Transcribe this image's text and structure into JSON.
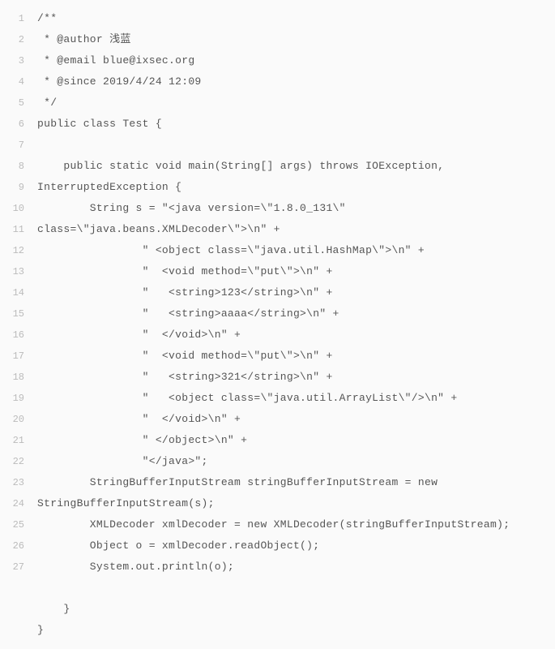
{
  "code": {
    "lines": [
      "/**",
      " * @author 浅蓝",
      " * @email blue@ixsec.org",
      " * @since 2019/4/24 12:09",
      " */",
      "public class Test {",
      "",
      "    public static void main(String[] args) throws IOException, ",
      "InterruptedException {",
      "        String s = \"<java version=\\\"1.8.0_131\\\" ",
      "class=\\\"java.beans.XMLDecoder\\\">\\n\" +",
      "                \" <object class=\\\"java.util.HashMap\\\">\\n\" +",
      "                \"  <void method=\\\"put\\\">\\n\" +",
      "                \"   <string>123</string>\\n\" +",
      "                \"   <string>aaaa</string>\\n\" +",
      "                \"  </void>\\n\" +",
      "                \"  <void method=\\\"put\\\">\\n\" +",
      "                \"   <string>321</string>\\n\" +",
      "                \"   <object class=\\\"java.util.ArrayList\\\"/>\\n\" +",
      "                \"  </void>\\n\" +",
      "                \" </object>\\n\" +",
      "                \"</java>\";",
      "        StringBufferInputStream stringBufferInputStream = new ",
      "StringBufferInputStream(s);",
      "        XMLDecoder xmlDecoder = new XMLDecoder(stringBufferInputStream);",
      "        Object o = xmlDecoder.readObject();",
      "        System.out.println(o);",
      "",
      "    }",
      "}"
    ]
  }
}
